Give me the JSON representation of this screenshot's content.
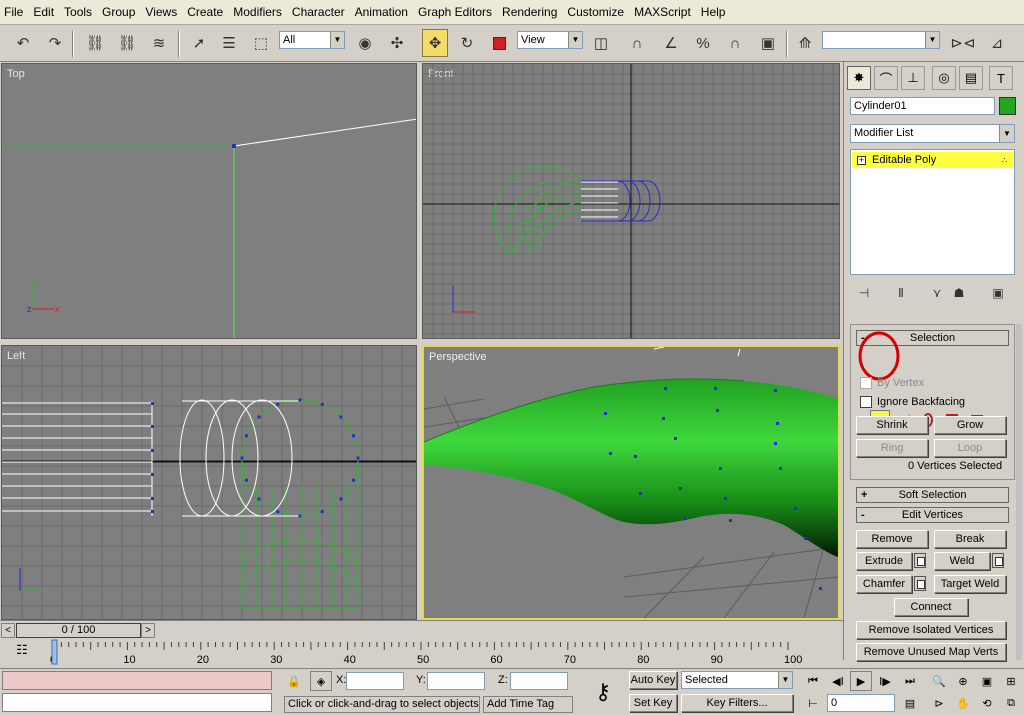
{
  "menu": [
    "File",
    "Edit",
    "Tools",
    "Group",
    "Views",
    "Create",
    "Modifiers",
    "Character",
    "Animation",
    "Graph Editors",
    "Rendering",
    "Customize",
    "MAXScript",
    "Help"
  ],
  "toolbar": {
    "selection_filter": "All",
    "ref_coord": "View",
    "named_selection": ""
  },
  "viewports": {
    "top": "Top",
    "front": "Front",
    "left": "Left",
    "perspective": "Perspective"
  },
  "command_panel": {
    "object_name": "Cylinder01",
    "object_color": "#23a623",
    "modifier_list": "Modifier List",
    "stack_item": "Editable Poly",
    "selection_rollout": "Selection",
    "by_vertex": "By Vertex",
    "ignore_backfacing": "Ignore Backfacing",
    "shrink": "Shrink",
    "grow": "Grow",
    "ring": "Ring",
    "loop": "Loop",
    "selected_count": "0 Vertices Selected",
    "soft_selection": "Soft Selection",
    "edit_vertices": "Edit Vertices",
    "remove": "Remove",
    "break": "Break",
    "extrude": "Extrude",
    "weld": "Weld",
    "chamfer": "Chamfer",
    "target_weld": "Target Weld",
    "connect": "Connect",
    "remove_isolated": "Remove Isolated Vertices",
    "remove_unused": "Remove Unused Map Verts"
  },
  "timeline": {
    "frame_display": "0 / 100",
    "ticks": [
      "0",
      "10",
      "20",
      "30",
      "40",
      "50",
      "60",
      "70",
      "80",
      "90",
      "100"
    ]
  },
  "status": {
    "x_label": "X:",
    "y_label": "Y:",
    "z_label": "Z:",
    "prompt": "Click or click-and-drag to select objects",
    "add_time_tag": "Add Time Tag",
    "auto_key": "Auto Key",
    "set_key": "Set Key",
    "key_mode": "Selected",
    "key_filters": "Key Filters...",
    "current_frame": "0"
  },
  "colors": {
    "viewport_bg": "#7f7f7f",
    "active_border": "#e8d84a",
    "wire_green": "#2fb52f",
    "vertex_blue": "#2a2acc",
    "highlight_circle": "#d40000"
  }
}
